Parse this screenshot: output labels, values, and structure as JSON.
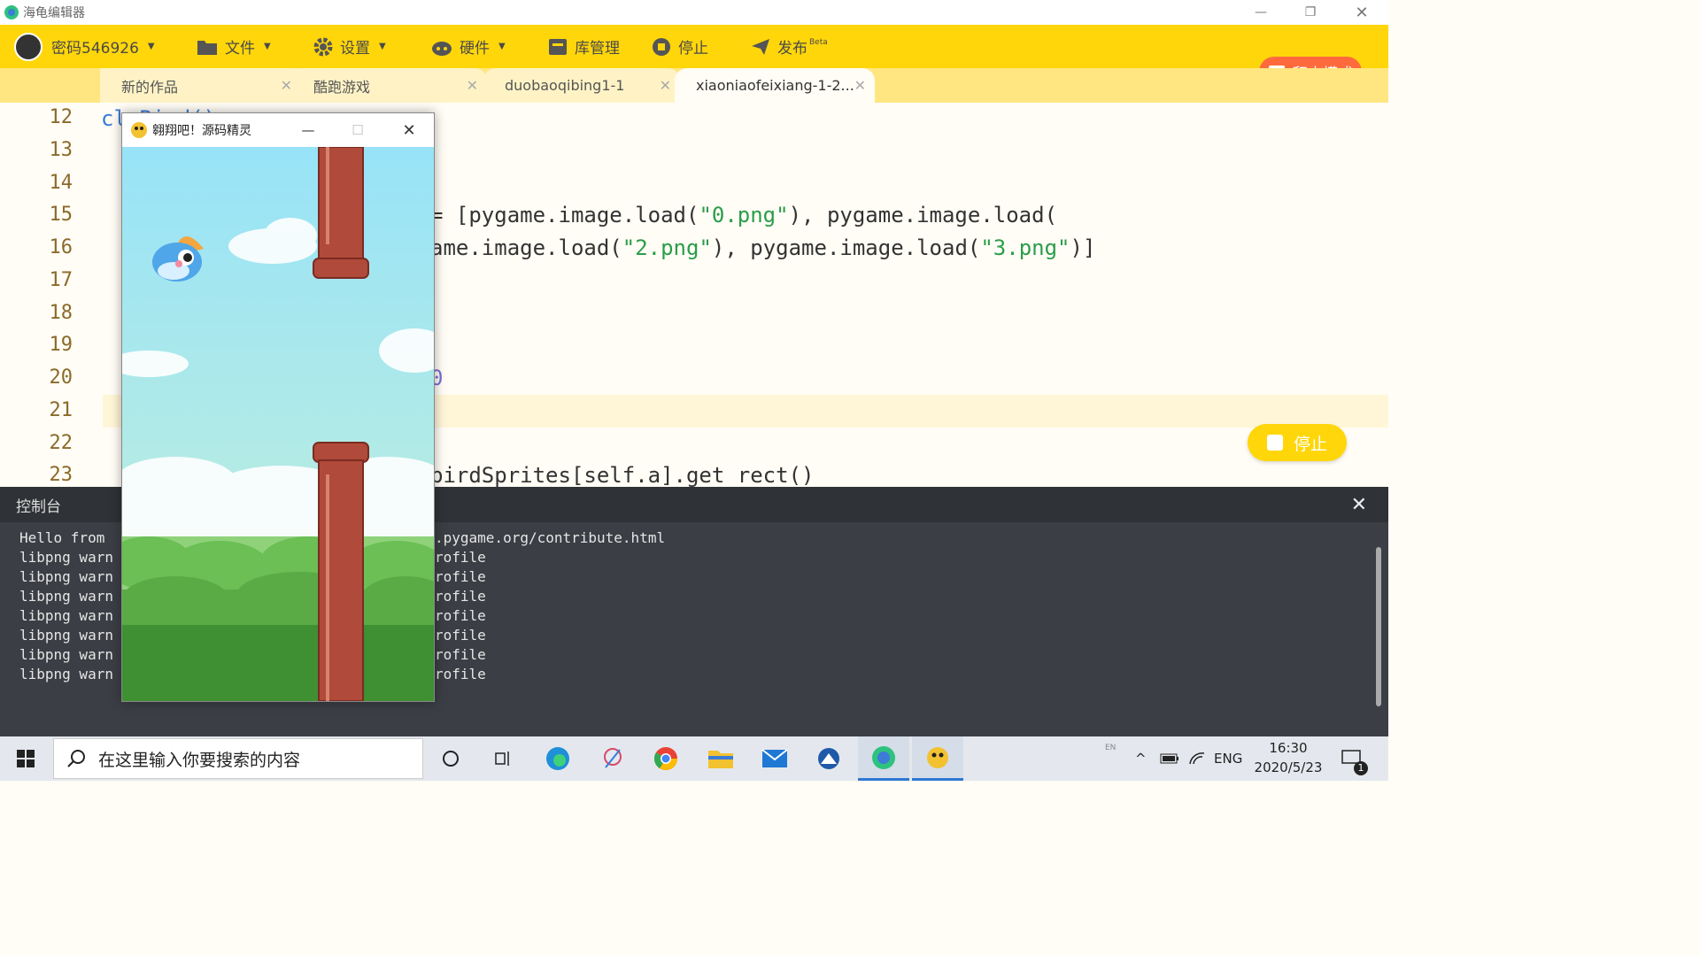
{
  "window": {
    "title": "海龟编辑器"
  },
  "toolbar": {
    "user": "密码546926",
    "file": "文件",
    "settings": "设置",
    "hardware": "硬件",
    "library": "库管理",
    "stop": "停止",
    "publish": "发布",
    "publish_badge": "Beta",
    "block_mode": "积木模式"
  },
  "tabs": [
    {
      "label": "新的作品"
    },
    {
      "label": "酷跑游戏"
    },
    {
      "label": "duobaoqibing1-1"
    },
    {
      "label": "xiaoniaofeixiang-1-2..."
    }
  ],
  "editor": {
    "line_numbers": [
      "12",
      "13",
      "14",
      "15",
      "16",
      "17",
      "18",
      "19",
      "20",
      "21",
      "22",
      "23"
    ],
    "line12": "cl",
    "line12b": "Bird()",
    "line15_pre": "= [pygame.image.load(",
    "line15_s1": "\"0.png\"",
    "line15_post": "), pygame.image.load(",
    "line16_pre": "ame.image.load(",
    "line16_s1": "\"2.png\"",
    "line16_mid": "), pygame.image.load(",
    "line16_s2": "\"3.png\"",
    "line16_post": ")]",
    "line20": "0",
    "line23": "birdSprites[self.a].get rect()",
    "stop_button": "停止"
  },
  "console": {
    "title": "控制台",
    "lines": [
      {
        "left": "Hello from",
        "right": ".pygame.org/contribute.html"
      },
      {
        "left": "libpng warn",
        "right": "rofile"
      },
      {
        "left": "libpng warn",
        "right": "rofile"
      },
      {
        "left": "libpng warn",
        "right": "rofile"
      },
      {
        "left": "libpng warn",
        "right": "rofile"
      },
      {
        "left": "libpng warn",
        "right": "rofile"
      },
      {
        "left": "libpng warn",
        "right": "rofile"
      },
      {
        "left": "libpng warn",
        "right": "rofile"
      }
    ]
  },
  "game_window": {
    "title": "翱翔吧！源码精灵"
  },
  "taskbar": {
    "search_placeholder": "在这里输入你要搜索的内容",
    "lang": "ENG",
    "time": "16:30",
    "date": "2020/5/23",
    "notifications": "1",
    "ime": "EN"
  },
  "colors": {
    "accent": "#ffd60a",
    "block_mode": "#ff6a3d",
    "console_bg": "#3b3e44",
    "pipe": "#b04a3a",
    "sky": "#9ee4f7",
    "bush": "#5fae4a"
  }
}
